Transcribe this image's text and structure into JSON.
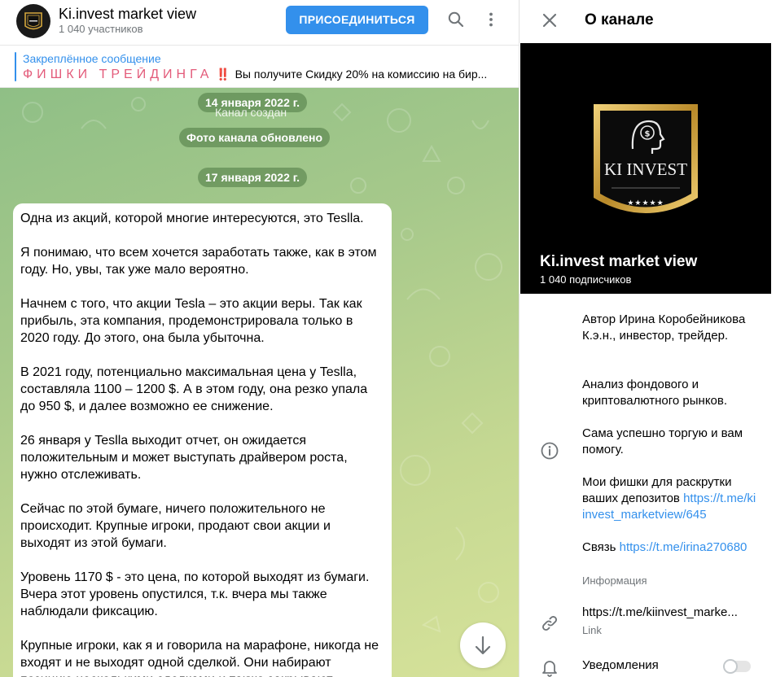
{
  "header": {
    "title": "Ki.invest market view",
    "members": "1 040 участников",
    "join_label": "ПРИСОЕДИНИТЬСЯ"
  },
  "pinned": {
    "label": "Закреплённое сообщение",
    "fancy": "ФИШКИ ТРЕЙДИНГА",
    "bang": "‼️",
    "text": "Вы получите Скидку 20% на комиссию на бир..."
  },
  "service": {
    "date1": "14 января 2022 г.",
    "created": "Канал создан",
    "photo_updated": "Фото канала обновлено",
    "date2": "17 января 2022 г."
  },
  "message": {
    "paragraphs": [
      "Одна из акций, которой многие интересуются, это Teslla.",
      "Я понимаю, что всем хочется заработать также, как в этом году. Но, увы, так уже мало вероятно.",
      "Начнем с того, что акции Tesla – это акции веры. Так как прибыль, эта компания, продемонстрировала только в 2020 году. До этого, она была убыточна.",
      "В 2021 году, потенциально максимальная цена у Teslla, составляла 1100 – 1200 $. А в этом году, она резко упала до 950 $, и далее возможно ее снижение.",
      "26 января у Teslla выходит отчет, он ожидается положительным и может выступать драйвером роста, нужно отслеживать.",
      "Сейчас по этой бумаге, ничего положительного не происходит. Крупные игроки, продают свои акции и выходят из этой бумаги.",
      "Уровень 1170 $ - это цена, по которой выходят из бумаги. Вчера этот уровень опустился, т.к. вчера мы также наблюдали фиксацию.",
      "Крупные игроки, как я и говорила на марафоне, никогда не входят и не выходят одной сделкой. Они набирают позицию несколькими сделками и также закрывают"
    ]
  },
  "panel": {
    "title": "О канале",
    "cover_logo_text": "KI INVEST",
    "cover_stars": "★★★★★",
    "channel_name": "Ki.invest market view",
    "subscribers": "1 040 подписчиков",
    "about_1": "Автор Ирина Коробейникова К.э.н., инвестор, трейдер.",
    "about_2": "Анализ фондового и криптовалютного рынков.",
    "about_3": "Сама успешно торгую и вам помогу.",
    "about_4_text": "Мои фишки для раскрутки ваших депозитов ",
    "about_4_link": "https://t.me/kiinvest_marketview/645",
    "about_5_text": "Связь ",
    "about_5_link": "https://t.me/irina270680",
    "info_caption": "Информация",
    "link_value": "https://t.me/kiinvest_marke...",
    "link_caption": "Link",
    "notifications_label": "Уведомления"
  },
  "icons": {
    "search": "search-icon",
    "more": "more-vertical-icon",
    "close": "close-icon",
    "info": "info-icon",
    "link": "link-icon",
    "bell": "bell-icon",
    "arrow_down": "arrow-down-icon"
  },
  "colors": {
    "accent": "#3390ec",
    "chat_bg_top": "#8fbf86",
    "chat_bg_bottom": "#d6e29a",
    "gold": "#d4a63c"
  }
}
